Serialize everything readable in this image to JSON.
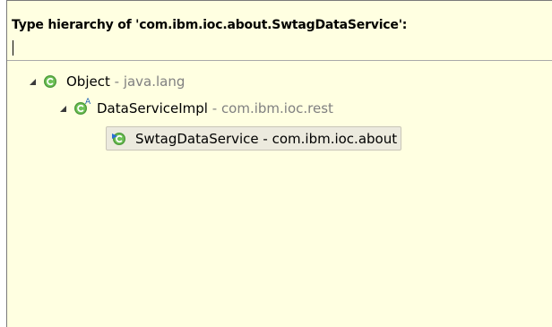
{
  "popup": {
    "title": "Type hierarchy of 'com.ibm.ioc.about.SwtagDataService':",
    "filter_value": ""
  },
  "tree": {
    "nodes": [
      {
        "name": "Object",
        "separator": " - ",
        "package": "java.lang",
        "expanded": true,
        "icon": "class-icon",
        "selected": false
      },
      {
        "name": "DataServiceImpl",
        "separator": " - ",
        "package": "com.ibm.ioc.rest",
        "expanded": true,
        "icon": "abstract-class-icon",
        "selected": false
      },
      {
        "name": "SwtagDataService",
        "separator": " - ",
        "package": "com.ibm.ioc.about",
        "expanded": false,
        "icon": "focus-class-icon",
        "selected": true
      }
    ]
  },
  "colors": {
    "background": "#ffffe1",
    "class_icon": "#4c9a3a",
    "package_text": "#808080",
    "selection": "#eceade"
  }
}
